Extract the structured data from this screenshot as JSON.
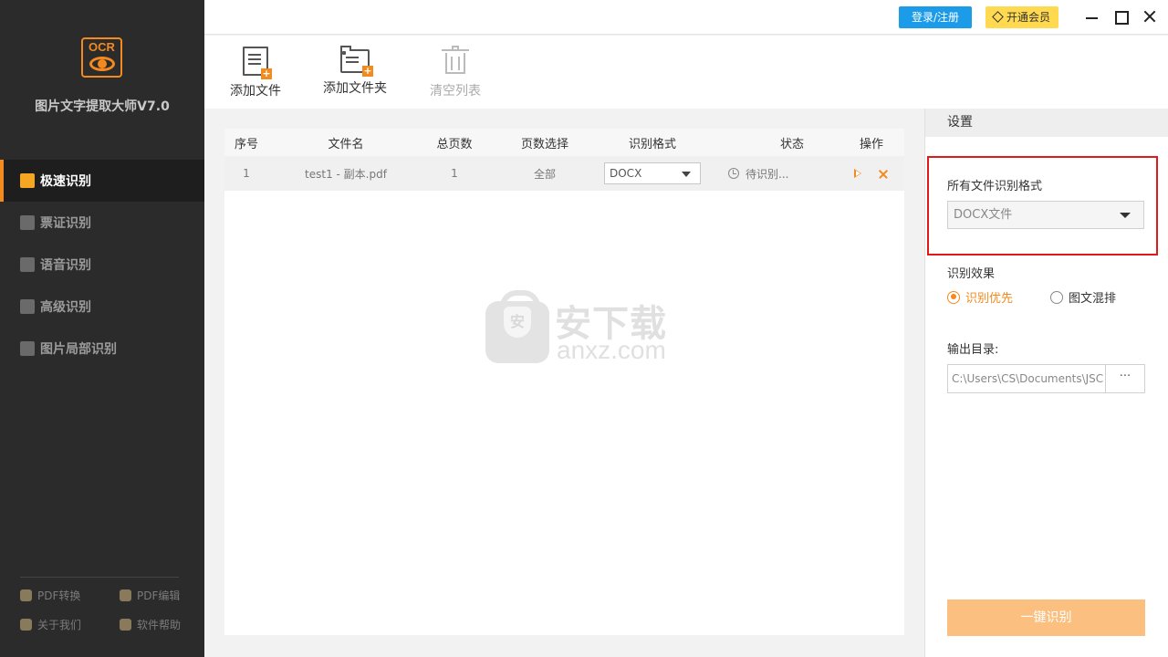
{
  "app": {
    "title": "图片文字提取大师V7.0",
    "logo_text": "OCR"
  },
  "sidebar": {
    "items": [
      {
        "label": "极速识别",
        "icon": "quick-ocr-icon",
        "active": true
      },
      {
        "label": "票证识别",
        "icon": "card-ocr-icon",
        "active": false
      },
      {
        "label": "语音识别",
        "icon": "microphone-icon",
        "active": false
      },
      {
        "label": "高级识别",
        "icon": "advanced-ocr-icon",
        "active": false
      },
      {
        "label": "图片局部识别",
        "icon": "image-region-icon",
        "active": false
      }
    ],
    "footer": [
      {
        "label": "PDF转换",
        "icon": "pdf-convert-icon"
      },
      {
        "label": "PDF编辑",
        "icon": "pdf-edit-icon"
      },
      {
        "label": "关于我们",
        "icon": "about-icon"
      },
      {
        "label": "软件帮助",
        "icon": "help-icon"
      }
    ]
  },
  "topbar": {
    "login_label": "登录/注册",
    "vip_label": "开通会员"
  },
  "toolbar": {
    "add_file_label": "添加文件",
    "add_folder_label": "添加文件夹",
    "clear_list_label": "清空列表"
  },
  "file_list": {
    "columns": [
      "序号",
      "文件名",
      "总页数",
      "页数选择",
      "识别格式",
      "状态",
      "操作"
    ],
    "rows": [
      {
        "index": "1",
        "name": "test1 - 副本.pdf",
        "pages": "1",
        "page_select": "全部",
        "format": "DOCX",
        "status": "待识别..."
      }
    ]
  },
  "watermark": {
    "cn": "安下载",
    "en": "anxz.com",
    "shield": "安"
  },
  "settings": {
    "title": "设置",
    "format_label": "所有文件识别格式",
    "format_value": "DOCX文件",
    "effect_label": "识别效果",
    "effect_options": [
      {
        "label": "识别优先",
        "checked": true
      },
      {
        "label": "图文混排",
        "checked": false
      }
    ],
    "output_label": "输出目录:",
    "output_path": "C:\\Users\\CS\\Documents\\JSC",
    "browse_label": "···",
    "run_label": "一键识别"
  },
  "colors": {
    "accent": "#f28a1f",
    "highlight_box": "#e01a1a",
    "login": "#1c9be9",
    "vip": "#ffd94f",
    "sidebar_bg": "#2b2b2b"
  }
}
